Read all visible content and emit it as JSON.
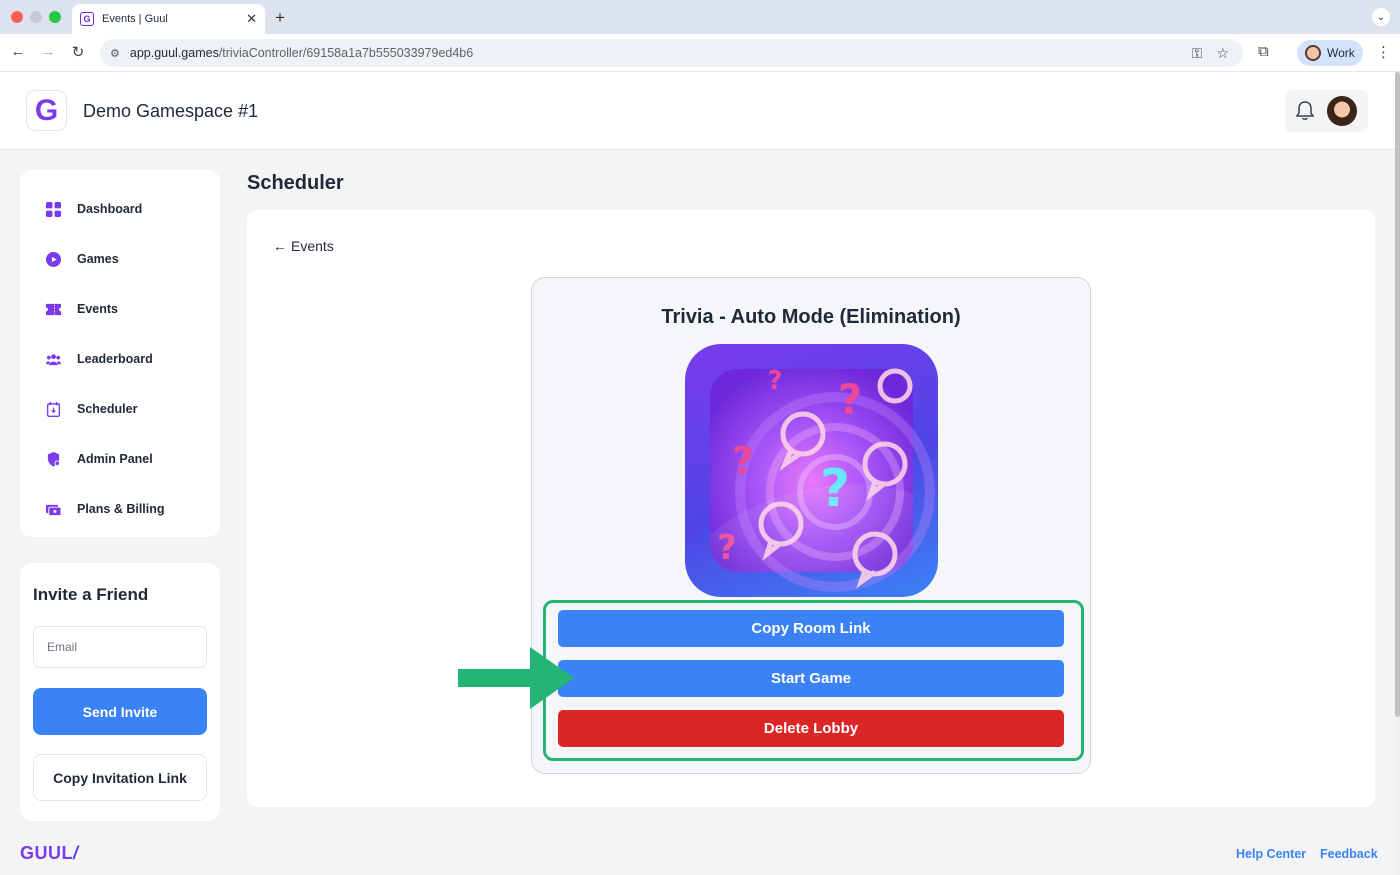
{
  "browser": {
    "tab_title": "Events | Guul",
    "tab_favicon": "G",
    "url_host": "app.guul.games",
    "url_path": "/triviaController/69158a1a7b555033979ed4b6",
    "profile_label": "Work"
  },
  "header": {
    "logo_letter": "G",
    "workspace_name": "Demo Gamespace #1"
  },
  "sidebar": {
    "items": [
      {
        "label": "Dashboard",
        "icon": "grid-icon"
      },
      {
        "label": "Games",
        "icon": "play-circle-icon"
      },
      {
        "label": "Events",
        "icon": "ticket-icon"
      },
      {
        "label": "Leaderboard",
        "icon": "users-icon"
      },
      {
        "label": "Scheduler",
        "icon": "calendar-icon"
      },
      {
        "label": "Admin Panel",
        "icon": "shield-icon"
      },
      {
        "label": "Plans & Billing",
        "icon": "billing-icon"
      }
    ]
  },
  "invite": {
    "title": "Invite a Friend",
    "email_placeholder": "Email",
    "send_label": "Send Invite",
    "copy_link_label": "Copy Invitation Link"
  },
  "main": {
    "page_title": "Scheduler",
    "back_label": "Events",
    "game": {
      "title": "Trivia - Auto Mode (Elimination)",
      "copy_room_link_label": "Copy Room Link",
      "start_game_label": "Start Game",
      "delete_lobby_label": "Delete Lobby"
    }
  },
  "footer": {
    "logo": "GUUL",
    "logo_slash": "/",
    "help_center": "Help Center",
    "feedback": "Feedback"
  },
  "colors": {
    "accent_purple": "#7c3aed",
    "primary_blue": "#3b82f6",
    "danger_red": "#dc2626",
    "highlight_green": "#22b573"
  }
}
